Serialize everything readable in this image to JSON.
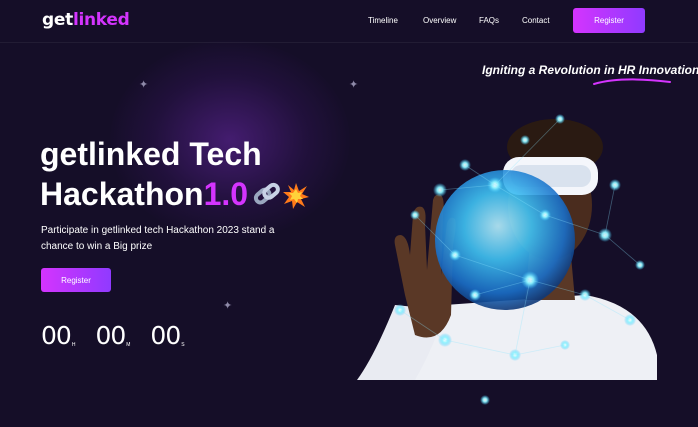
{
  "header": {
    "logo_main": "get",
    "logo_accent": "linked",
    "nav": [
      "Timeline",
      "Overview",
      "FAQs",
      "Contact"
    ],
    "register_label": "Register"
  },
  "hero": {
    "tagline": "Igniting a Revolution in HR Innovation",
    "title_line1": "getlinked Tech",
    "title_line2_main": "Hackathon",
    "title_version": "1.0",
    "description": "Participate in getlinked tech Hackathon 2023 stand a chance to win a Big prize",
    "register_label": "Register",
    "countdown": [
      {
        "value": "00",
        "unit": "H"
      },
      {
        "value": "00",
        "unit": "M"
      },
      {
        "value": "00",
        "unit": "S"
      }
    ]
  },
  "colors": {
    "background": "#150e28",
    "accent": "#d434fe",
    "button_gradient_end": "#903aff"
  },
  "icons": [
    "chain-link-icon",
    "collision-burst-icon",
    "sparkle-star-icon"
  ]
}
